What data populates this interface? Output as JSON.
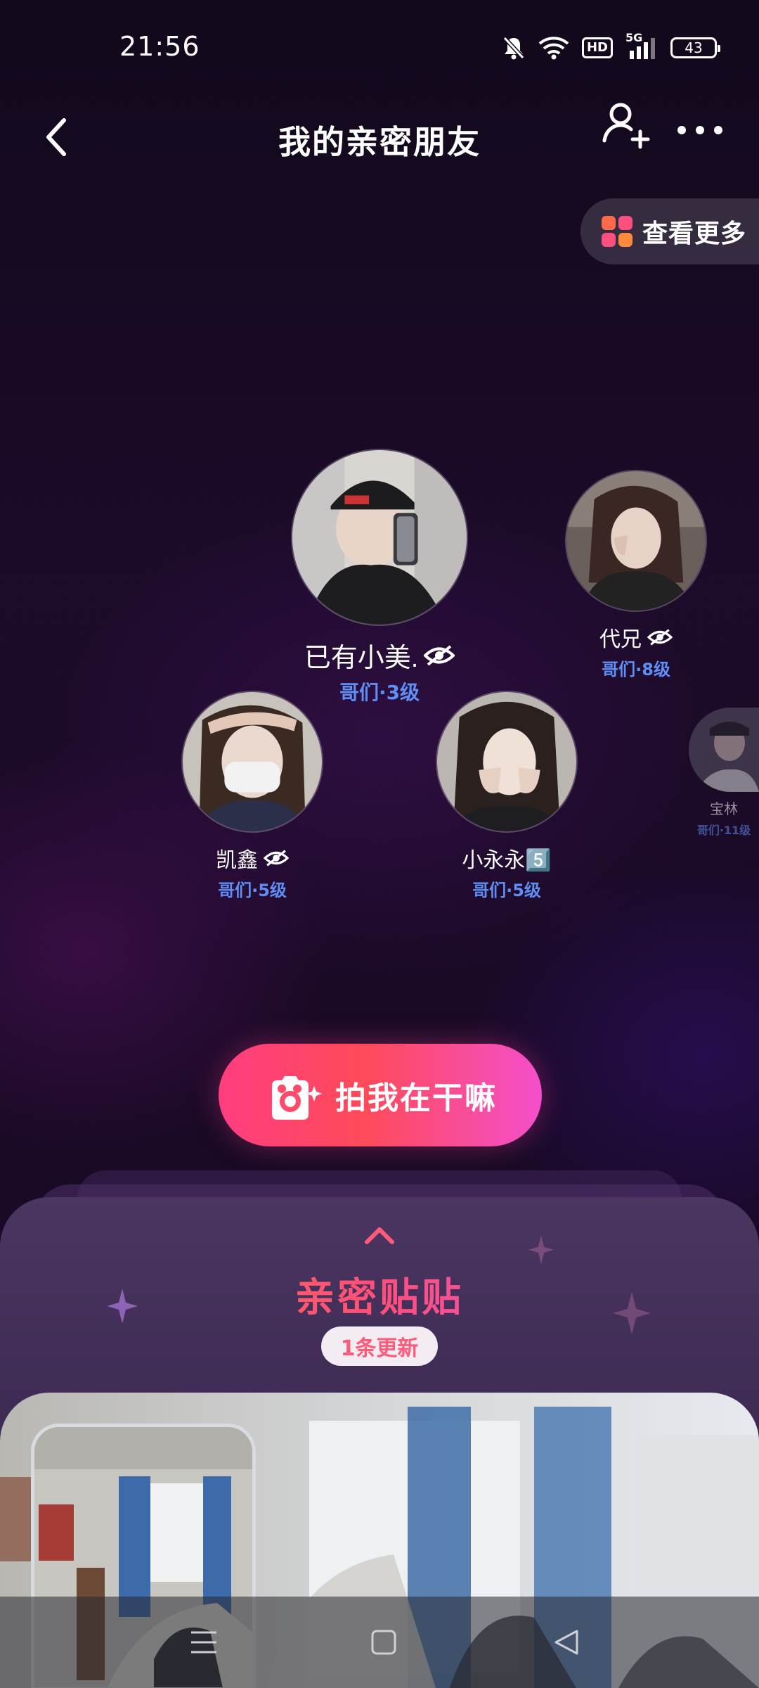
{
  "status_bar": {
    "time": "21:56",
    "hd": "HD",
    "network": "5G",
    "battery": "43"
  },
  "header": {
    "title": "我的亲密朋友"
  },
  "view_more": {
    "label": "查看更多",
    "icon": "app-grid-icon"
  },
  "friends": [
    {
      "name": "已有小美.",
      "level": "哥们·3级",
      "hidden": true
    },
    {
      "name": "代兄",
      "level": "哥们·8级",
      "hidden": true
    },
    {
      "name": "凯鑫",
      "level": "哥们·5级",
      "hidden": true
    },
    {
      "name": "小永永5️⃣",
      "level": "哥们·5级",
      "hidden": false
    },
    {
      "name": "宝林",
      "level": "哥们·11级",
      "hidden": false
    }
  ],
  "cta": {
    "label": "拍我在干嘛",
    "icon": "camera-sparkle-icon"
  },
  "intimate_section": {
    "title": "亲密贴贴",
    "update_badge": "1条更新"
  },
  "colors": {
    "accent_pink": "#ff3e80",
    "level_blue": "#5f8ff5",
    "background": "#1a0a26"
  }
}
